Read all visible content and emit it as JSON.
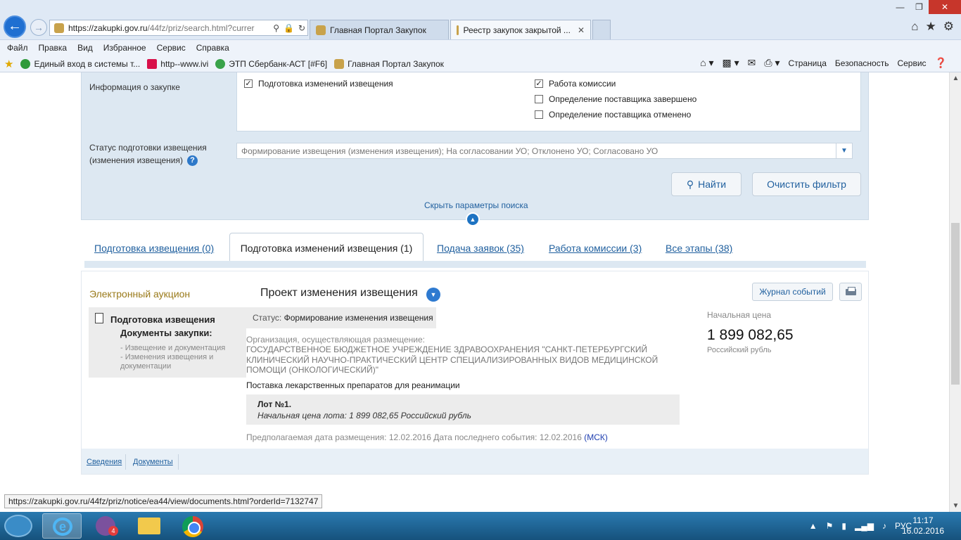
{
  "browser": {
    "url_main": "https://zakupki.gov.ru",
    "url_rest": "/44fz/priz/search.html?currer",
    "tabs": [
      {
        "label": "Главная Портал Закупок"
      },
      {
        "label": "Реестр закупок закрытой ..."
      }
    ],
    "menu": [
      "Файл",
      "Правка",
      "Вид",
      "Избранное",
      "Сервис",
      "Справка"
    ],
    "favorites": [
      "Единый вход в системы т...",
      "http--www.ivi",
      "ЭТП Сбербанк-АСТ [#F6]",
      "Главная Портал Закупок"
    ],
    "commands": {
      "page": "Страница",
      "security": "Безопасность",
      "service": "Сервис"
    },
    "status_url": "https://zakupki.gov.ru/44fz/priz/notice/ea44/view/documents.html?orderId=7132747"
  },
  "search": {
    "info_label": "Информация о закупке",
    "checkboxes": [
      {
        "label": "Подготовка изменений извещения",
        "checked": true
      },
      {
        "label": "Работа комиссии",
        "checked": true
      },
      {
        "label": "Определение поставщика завершено",
        "checked": false
      },
      {
        "label": "Определение поставщика отменено",
        "checked": false
      }
    ],
    "status_label_1": "Статус подготовки извещения",
    "status_label_2": "(изменения извещения)",
    "status_placeholder": "Формирование извещения (изменения извещения); На согласовании УО; Отклонено УО; Согласовано УО",
    "find_button": "Найти",
    "clear_button": "Очистить фильтр",
    "hide_link": "Скрыть параметры поиска"
  },
  "result_tabs": [
    {
      "label": "Подготовка извещения (0)"
    },
    {
      "label": "Подготовка изменений извещения (1)"
    },
    {
      "label": "Подача заявок (35)"
    },
    {
      "label": "Работа комиссии (3)"
    },
    {
      "label": "Все этапы (38)"
    }
  ],
  "card": {
    "type": "Электронный аукцион",
    "project": "Проект изменения извещения",
    "journal_button": "Журнал событий",
    "stage": "Подготовка извещения",
    "docs_heading": "Документы закупки:",
    "doc_link_1": "- Извещение и документация",
    "doc_link_2a": "- Изменения извещения и",
    "doc_link_2b": "документации",
    "status_prefix": "Статус:",
    "status_value": "Формирование изменения извещения",
    "org_label": "Организация, осуществляющая размещение:",
    "org_name": "ГОСУДАРСТВЕННОЕ БЮДЖЕТНОЕ УЧРЕЖДЕНИЕ ЗДРАВООХРАНЕНИЯ \"САНКТ-ПЕТЕРБУРГСКИЙ КЛИНИЧЕСКИЙ НАУЧНО-ПРАКТИЧЕСКИЙ ЦЕНТР СПЕЦИАЛИЗИРОВАННЫХ ВИДОВ МЕДИЦИНСКОЙ ПОМОЩИ (ОНКОЛОГИЧЕСКИЙ)\"",
    "subject": "Поставка лекарственных препаратов для реанимации",
    "lot_title": "Лот №1.",
    "lot_price": "Начальная цена лота: 1 899 082,65 Российский рубль",
    "dates_text": "Предполагаемая дата размещения: 12.02.2016  Дата последнего события: 12.02.2016",
    "msk": "(МСК)",
    "price_label": "Начальная цена",
    "price_value": "1 899 082,65",
    "currency": "Российский рубль",
    "footer_links": [
      "Сведения",
      "Документы"
    ]
  },
  "taskbar": {
    "viber_badge": "4",
    "lang": "РУС",
    "time": "11:17",
    "date": "16.02.2016"
  }
}
